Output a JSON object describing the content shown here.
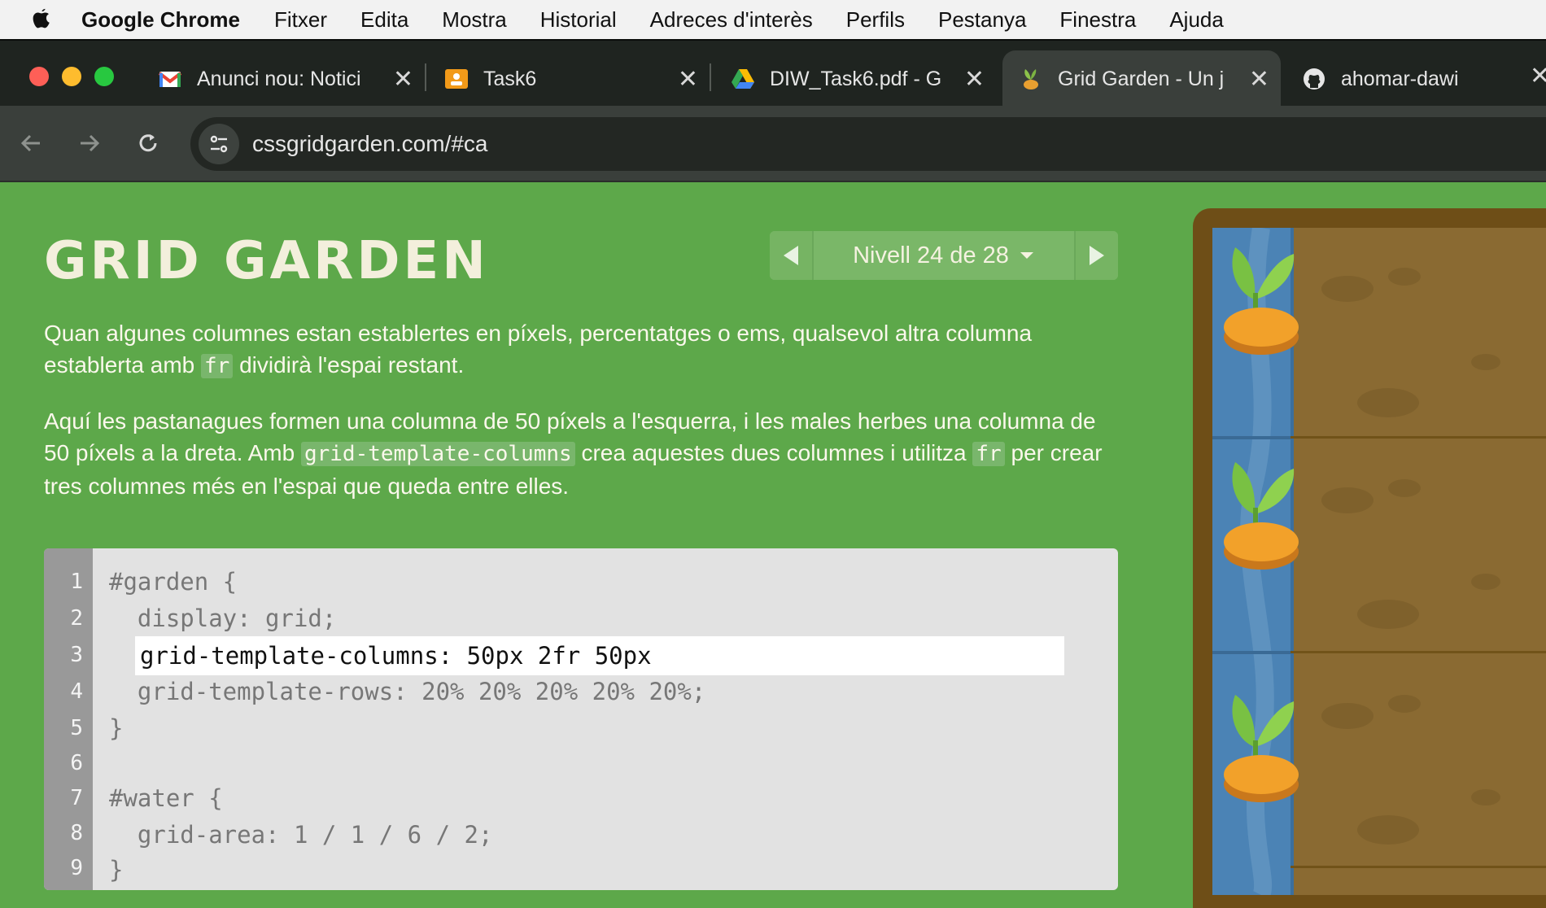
{
  "menubar": {
    "app": "Google Chrome",
    "items": [
      "Fitxer",
      "Edita",
      "Mostra",
      "Historial",
      "Adreces d'interès",
      "Perfils",
      "Pestanya",
      "Finestra",
      "Ajuda"
    ]
  },
  "tabs": [
    {
      "title": "Anunci nou: Notici",
      "icon": "gmail-icon"
    },
    {
      "title": "Task6",
      "icon": "classroom-icon"
    },
    {
      "title": "DIW_Task6.pdf - G",
      "icon": "drive-icon"
    },
    {
      "title": "Grid Garden - Un j",
      "icon": "sprout-icon",
      "active": true
    },
    {
      "title": "ahomar-dawi",
      "icon": "github-icon"
    }
  ],
  "toolbar": {
    "url": "cssgridgarden.com/#ca"
  },
  "page": {
    "title": "GRID GARDEN",
    "level_label": "Nivell 24 de 28",
    "p1_before": "Quan algunes columnes estan establertes en píxels, percentatges o ems, qualsevol altra columna establerta amb ",
    "p1_code": "fr",
    "p1_after": " dividirà l'espai restant.",
    "p2_a": "Aquí les pastanagues formen una columna de 50 píxels a l'esquerra, i les males herbes una columna de 50 píxels a la dreta. Amb ",
    "p2_code1": "grid-template-columns",
    "p2_b": " crea aquestes dues columnes i utilitza ",
    "p2_code2": "fr",
    "p2_c": " per crear tres columnes més en l'espai que queda entre elles."
  },
  "editor": {
    "line_numbers": [
      "1",
      "2",
      "3",
      "4",
      "5",
      "6",
      "7",
      "8",
      "9"
    ],
    "lines": [
      "#garden {",
      "  display: grid;",
      "",
      "  grid-template-rows: 20% 20% 20% 20% 20%;",
      "}",
      "",
      "#water {",
      "  grid-area: 1 / 1 / 6 / 2;",
      "}"
    ],
    "input_value": "grid-template-columns: 50px 2fr 50px"
  },
  "colors": {
    "background": "#5da84a",
    "title": "#f3efdc",
    "water": "#4b83b5",
    "soil": "#8a6a32",
    "carrot": "#f2a12a"
  }
}
